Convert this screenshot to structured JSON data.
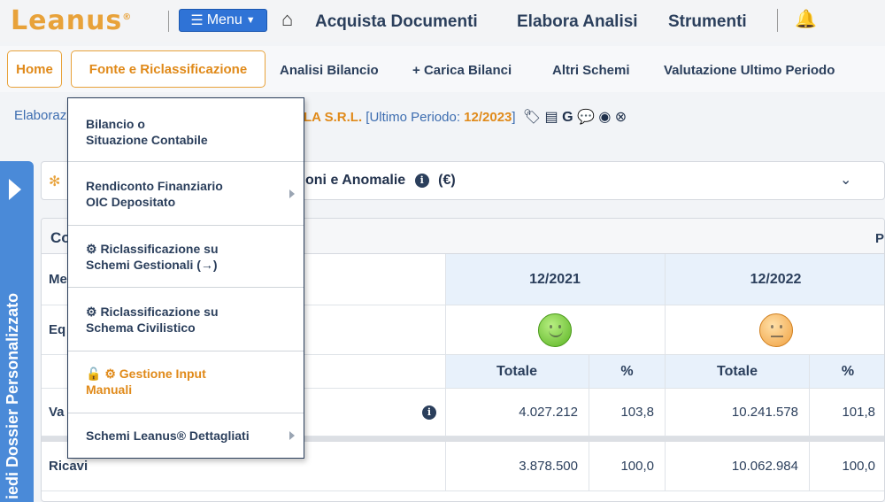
{
  "topbar": {
    "logo": "Leanus",
    "logo_mark": "®",
    "menu_label": "Menu",
    "nav": [
      "Acquista Documenti",
      "Elabora Analisi",
      "Strumenti"
    ]
  },
  "subnav": {
    "tabs": [
      "Home",
      "Fonte e Riclassificazione"
    ],
    "links": [
      "Analisi Bilancio",
      "Carica Bilanci",
      "Altri Schemi",
      "Valutazione Ultimo Periodo"
    ],
    "carica_prefix": "+"
  },
  "breadcrumb": {
    "prefix": "Elaboraz",
    "company": "LA S.R.L.",
    "period_label": "[Ultimo Periodo:",
    "period_value": "12/2023",
    "period_close": "]"
  },
  "sidebar": {
    "label": "iedi Dossier Personalizzato"
  },
  "panel1": {
    "title": "oni e Anomalie",
    "unit": "(€)"
  },
  "panel2": {
    "title": "Co",
    "right_label": "P",
    "rows": {
      "header_label": "Me",
      "eq_label": "Eq",
      "va_label": "Va",
      "ricavi_label": "Ricavi"
    },
    "periods": [
      "12/2021",
      "12/2022"
    ],
    "col_totale": "Totale",
    "col_pct": "%",
    "va_values": [
      "4.027.212",
      "103,8",
      "10.241.578",
      "101,8"
    ],
    "ricavi_values": [
      "3.878.500",
      "100,0",
      "10.062.984",
      "100,0"
    ]
  },
  "dropdown": {
    "items": [
      {
        "line1": "Bilancio o",
        "line2": "Situazione Contabile"
      },
      {
        "line1": "Rendiconto Finanziario",
        "line2": "OIC Depositato"
      },
      {
        "line1": "⚙ Riclassificazione su",
        "line2": "Schemi Gestionali (→)"
      },
      {
        "line1": "⚙ Riclassificazione su",
        "line2": "Schema Civilistico"
      },
      {
        "line1": "🔓 ⚙ Gestione Input",
        "line2": "Manuali"
      },
      {
        "line1": "Schemi Leanus® Dettagliati",
        "line2": ""
      }
    ]
  },
  "colors": {
    "accent": "#e8a23a",
    "brand_blue": "#2f73d6",
    "text_navy": "#2b3f5c"
  }
}
